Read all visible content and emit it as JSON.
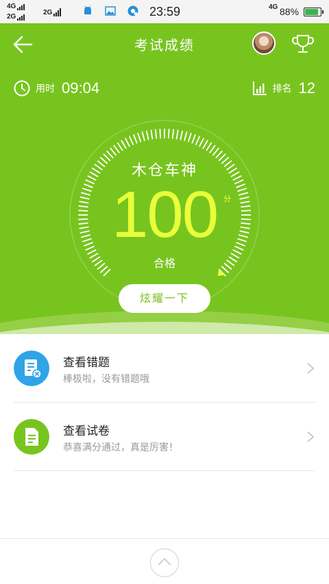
{
  "status_bar": {
    "sim1_type": "4G",
    "sim2_type": "2G",
    "sim3_type": "2G",
    "time": "23:59",
    "battery_network": "4G",
    "battery_percent": "88%",
    "battery_level": 0.88,
    "icons": [
      "android-icon",
      "image-icon",
      "app-notification-icon"
    ]
  },
  "header": {
    "title": "考试成绩",
    "back_icon": "arrow-left-icon",
    "trophy_icon": "trophy-icon"
  },
  "stats": {
    "time_label": "用时",
    "time_value": "09:04",
    "rank_label": "排名",
    "rank_value": "12"
  },
  "result": {
    "rank_title": "木仓车神",
    "score": "100",
    "score_unit": "分",
    "verdict": "合格",
    "share_button": "炫耀一下",
    "gauge_fraction": 1.0
  },
  "list": [
    {
      "title": "查看错题",
      "subtitle": "棒极啦，没有错题哦",
      "icon": "wrong-questions-icon",
      "color": "#2fa4e7"
    },
    {
      "title": "查看试卷",
      "subtitle": "恭喜满分通过，真是厉害！",
      "icon": "exam-paper-icon",
      "color": "#78c41f"
    }
  ],
  "colors": {
    "accent_green": "#78c41f",
    "score_yellow": "#e8ff3a",
    "blue": "#2fa4e7"
  }
}
